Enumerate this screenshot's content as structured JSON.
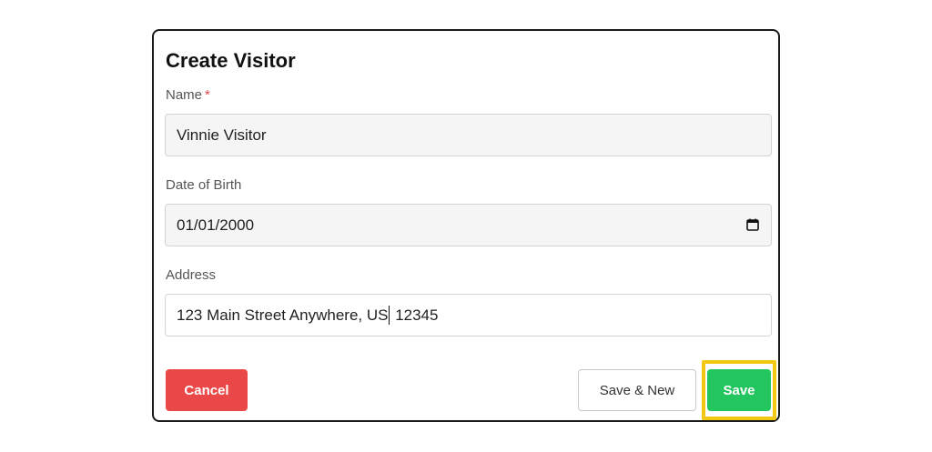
{
  "dialog": {
    "title": "Create Visitor",
    "fields": {
      "name": {
        "label": "Name",
        "required_mark": "*",
        "value": "Vinnie Visitor"
      },
      "dob": {
        "label": "Date of Birth",
        "value": "01/01/2000",
        "icon": "calendar-icon"
      },
      "address": {
        "label": "Address",
        "value_before_cursor": "123 Main Street Anywhere, US",
        "value_after_cursor": " 12345"
      }
    },
    "buttons": {
      "cancel": "Cancel",
      "save_new": "Save & New",
      "save": "Save"
    },
    "colors": {
      "cancel": "#ea4848",
      "save": "#22c55e",
      "highlight": "#f2c811",
      "required": "#e14a4a"
    }
  }
}
